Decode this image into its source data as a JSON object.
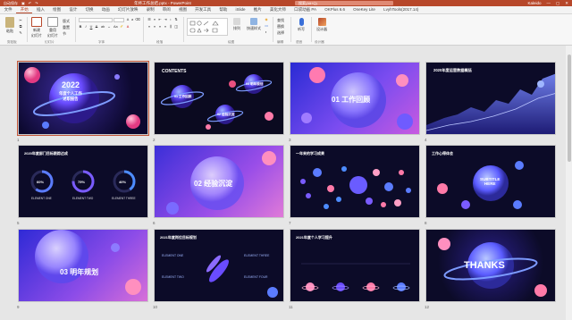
{
  "titlebar": {
    "autosave": "自动保存",
    "title": "年终工作总结.pptx  -  PowerPoint",
    "search_placeholder": "搜索(Alt+Q)",
    "account": "Kaleido",
    "controls": [
      "—",
      "▢",
      "✕"
    ]
  },
  "tabs": [
    {
      "label": "文件",
      "active": false
    },
    {
      "label": "开始",
      "active": true
    },
    {
      "label": "插入",
      "active": false
    },
    {
      "label": "绘图",
      "active": false
    },
    {
      "label": "设计",
      "active": false
    },
    {
      "label": "切换",
      "active": false
    },
    {
      "label": "动画",
      "active": false
    },
    {
      "label": "幻灯片放映",
      "active": false
    },
    {
      "label": "录制",
      "active": false
    },
    {
      "label": "审阅",
      "active": false
    },
    {
      "label": "视图",
      "active": false
    },
    {
      "label": "开发工具",
      "active": false
    },
    {
      "label": "帮助",
      "active": false
    },
    {
      "label": "iSlide",
      "active": false
    },
    {
      "label": "推片",
      "active": false
    },
    {
      "label": "美化大师",
      "active": false
    },
    {
      "label": "口袋动画 PA",
      "active": false
    },
    {
      "label": "OKPlus 6.6",
      "active": false
    },
    {
      "label": "OneKey Lite",
      "active": false
    },
    {
      "label": "LvyhTools(2017.14)",
      "active": false
    }
  ],
  "ribbon": {
    "paste": "粘贴",
    "new_slide": "新建\n幻灯片",
    "reuse": "重用\n幻灯片",
    "layout": "版式",
    "reset": "重置",
    "section": "节",
    "font_name": "",
    "font_size": "",
    "bold": "B",
    "italic": "I",
    "underline": "U",
    "strike": "S",
    "shapes": "形状",
    "arrange": "排列",
    "quick_styles": "快速样式",
    "find": "查找",
    "replace": "替换",
    "select": "选择",
    "dictate": "听写",
    "designer": "设计器",
    "groups": [
      "剪贴板",
      "幻灯片",
      "字体",
      "段落",
      "绘图",
      "编辑",
      "语音",
      "设计器"
    ]
  },
  "slides": [
    {
      "num": "1",
      "title": "2022",
      "subtitle": "年度个人工作\n述职报告",
      "kind": "cover"
    },
    {
      "num": "2",
      "title": "CONTENTS",
      "items": [
        "01 工作回顾",
        "02 经验沉淀",
        "03 明年规划"
      ],
      "kind": "contents"
    },
    {
      "num": "3",
      "title": "01 工作回顾",
      "kind": "section"
    },
    {
      "num": "4",
      "title": "2020年度运营数据概括",
      "kind": "area"
    },
    {
      "num": "5",
      "title": "2020年度部门目标跟踪达成",
      "kind": "rings",
      "rings": [
        {
          "value": "60%",
          "label": "ELEMENT ONE"
        },
        {
          "value": "75%",
          "label": "ELEMENT TWO"
        },
        {
          "value": "40%",
          "label": "ELEMENT THREE"
        }
      ]
    },
    {
      "num": "6",
      "title": "02 经验沉淀",
      "kind": "section2"
    },
    {
      "num": "7",
      "title": "一年来的学习成果",
      "kind": "balls"
    },
    {
      "num": "8",
      "title": "工作心得体会",
      "center": "SUBTITLE\nHERE",
      "kind": "orbit"
    },
    {
      "num": "9",
      "title": "03 明年规划",
      "kind": "section3"
    },
    {
      "num": "10",
      "title": "2021年度岗位目标规划",
      "items": [
        "ELEMENT ONE",
        "ELEMENT THREE",
        "ELEMENT TWO",
        "ELEMENT FOUR"
      ],
      "kind": "goals"
    },
    {
      "num": "11",
      "title": "2021年度个人学习提升",
      "kind": "planets"
    },
    {
      "num": "12",
      "title": "THANKS",
      "kind": "thanks"
    }
  ],
  "colors": {
    "accent": "#b7472a",
    "purple": "#6a4cff",
    "pink": "#ff6fa8",
    "dark": "#0f0a2a"
  }
}
